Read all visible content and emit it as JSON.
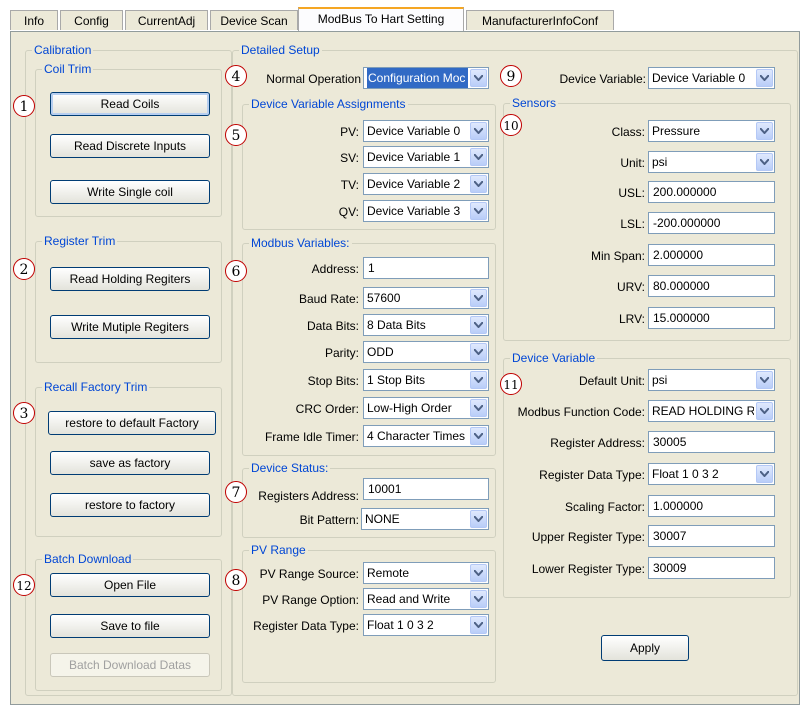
{
  "tabs": [
    "Info",
    "Config",
    "CurrentAdj",
    "Device Scan",
    "ModBus To Hart Setting",
    "ManufacturerInfoConf"
  ],
  "calibration": {
    "title": "Calibration",
    "coil_trim": {
      "title": "Coil Trim",
      "read_coils": "Read Coils",
      "read_discrete": "Read Discrete Inputs",
      "write_single": "Write Single coil"
    },
    "register_trim": {
      "title": "Register Trim",
      "read_holding": "Read Holding Regiters",
      "write_multiple": "Write Mutiple Regiters"
    },
    "recall_factory": {
      "title": "Recall Factory Trim",
      "restore_default": "restore to default Factory",
      "save_factory": "save as factory",
      "restore_factory": "restore to factory"
    },
    "batch": {
      "title": "Batch Download",
      "open_file": "Open File",
      "save_file": "Save to file",
      "batch_datas": "Batch Download Datas"
    }
  },
  "detailed": {
    "title": "Detailed Setup",
    "normal_operation": {
      "label": "Normal Operation",
      "value": "Configuration Moc"
    },
    "device_variable": {
      "label": "Device Variable:",
      "value": "Device Variable 0"
    },
    "assignments": {
      "title": "Device Variable Assignments",
      "pv": {
        "label": "PV:",
        "value": "Device Variable 0"
      },
      "sv": {
        "label": "SV:",
        "value": "Device Variable 1"
      },
      "tv": {
        "label": "TV:",
        "value": "Device Variable 2"
      },
      "qv": {
        "label": "QV:",
        "value": "Device Variable 3"
      }
    },
    "modbus": {
      "title": "Modbus Variables:",
      "address": {
        "label": "Address:",
        "value": "1"
      },
      "baud": {
        "label": "Baud Rate:",
        "value": "57600"
      },
      "databits": {
        "label": "Data Bits:",
        "value": "8 Data Bits"
      },
      "parity": {
        "label": "Parity:",
        "value": "ODD"
      },
      "stopbits": {
        "label": "Stop Bits:",
        "value": "1 Stop Bits"
      },
      "crc": {
        "label": "CRC Order:",
        "value": "Low-High Order"
      },
      "idle": {
        "label": "Frame Idle Timer:",
        "value": "4 Character Times"
      }
    },
    "status": {
      "title": "Device Status:",
      "reg_addr": {
        "label": "Registers Address:",
        "value": "10001"
      },
      "bit_pattern": {
        "label": "Bit Pattern:",
        "value": "NONE"
      }
    },
    "pv_range": {
      "title": "PV Range",
      "source": {
        "label": "PV Range Source:",
        "value": "Remote"
      },
      "option": {
        "label": "PV Range Option:",
        "value": "Read and Write"
      },
      "reg_type": {
        "label": "Register Data Type:",
        "value": "Float 1 0 3 2"
      }
    },
    "sensors": {
      "title": "Sensors",
      "class": {
        "label": "Class:",
        "value": "Pressure"
      },
      "unit": {
        "label": "Unit:",
        "value": "psi"
      },
      "usl": {
        "label": "USL:",
        "value": "200.000000"
      },
      "lsl": {
        "label": "LSL:",
        "value": "-200.000000"
      },
      "minspan": {
        "label": "Min Span:",
        "value": "2.000000"
      },
      "urv": {
        "label": "URV:",
        "value": "80.000000"
      },
      "lrv": {
        "label": "LRV:",
        "value": "15.000000"
      }
    },
    "devvar": {
      "title": "Device  Variable",
      "default_unit": {
        "label": "Default Unit:",
        "value": "psi"
      },
      "func_code": {
        "label": "Modbus Function Code:",
        "value": "READ HOLDING RE"
      },
      "reg_addr": {
        "label": "Register Address:",
        "value": "30005"
      },
      "reg_type": {
        "label": "Register Data Type:",
        "value": "Float 1 0 3 2"
      },
      "scaling": {
        "label": "Scaling Factor:",
        "value": "1.000000"
      },
      "upper": {
        "label": "Upper Register Type:",
        "value": "30007"
      },
      "lower": {
        "label": "Lower Register Type:",
        "value": "30009"
      }
    },
    "apply": "Apply"
  },
  "badges": [
    "1",
    "2",
    "3",
    "4",
    "5",
    "6",
    "7",
    "8",
    "9",
    "10",
    "11",
    "12"
  ]
}
